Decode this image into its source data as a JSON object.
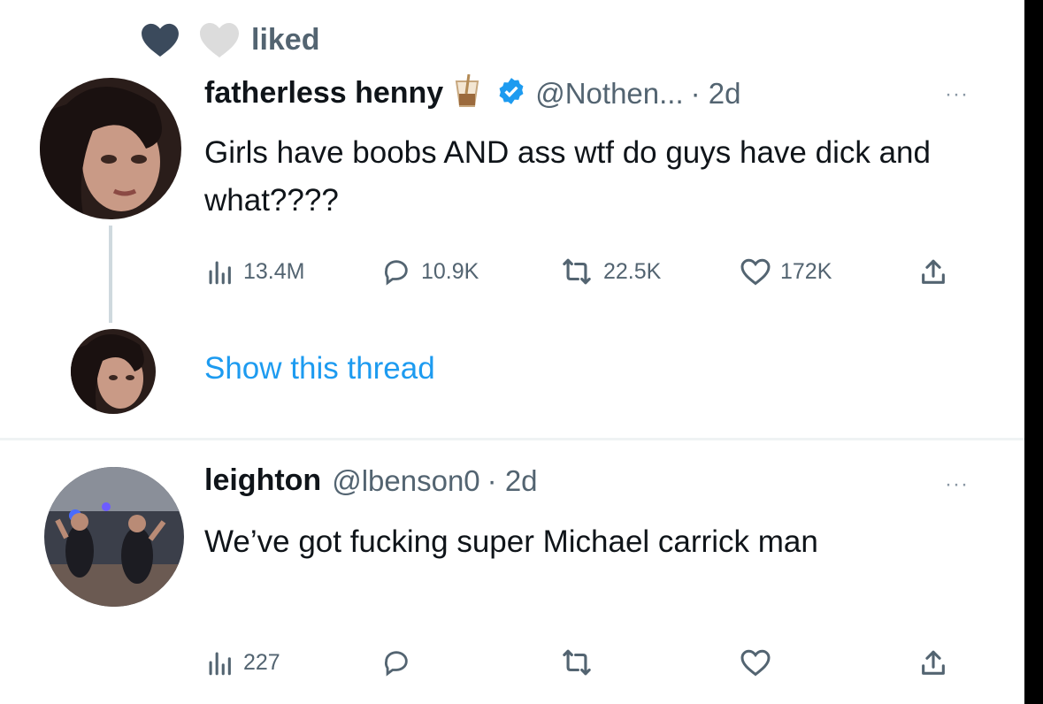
{
  "liked_label": "liked",
  "tweet1": {
    "display_name": "fatherless henny",
    "handle": "@Nothen...",
    "time": "· 2d",
    "text": "Girls have boobs AND ass wtf do guys have dick and what????",
    "views": "13.4M",
    "replies": "10.9K",
    "retweets": "22.5K",
    "likes": "172K"
  },
  "show_thread": "Show this thread",
  "tweet2": {
    "display_name": "leighton",
    "handle": "@lbenson0",
    "time": "· 2d",
    "text": "We’ve got fucking super Michael carrick man",
    "views": "227"
  },
  "more_label": "···",
  "colors": {
    "text": "#0f1419",
    "muted": "#536471",
    "link": "#1d9bf0",
    "verified": "#1d9bf0",
    "heart_dark": "#3b4a5c"
  }
}
